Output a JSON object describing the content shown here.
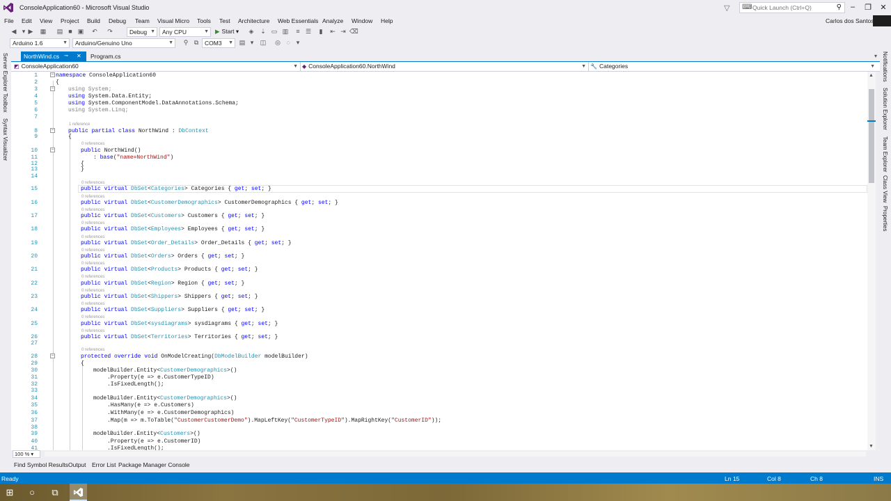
{
  "window": {
    "title": "ConsoleApplication60 - Microsoft Visual Studio",
    "quick_launch_placeholder": "Quick Launch (Ctrl+Q)",
    "user": "Carlos dos Santos"
  },
  "menu": [
    "File",
    "Edit",
    "View",
    "Project",
    "Build",
    "Debug",
    "Team",
    "Visual Micro",
    "Tools",
    "Test",
    "Architecture",
    "Web Essentials",
    "Analyze",
    "Window",
    "Help"
  ],
  "toolbar": {
    "config": "Debug",
    "platform": "Any CPU",
    "start_label": "Start"
  },
  "toolbar2": {
    "board_version": "Arduino 1.6",
    "board": "Arduino/Genuino Uno",
    "port": "COM3"
  },
  "side_tabs_left": [
    "Server Explorer",
    "Toolbox",
    "Syntax Visualizer"
  ],
  "side_tabs_right": [
    "Notifications",
    "Solution Explorer",
    "Team Explorer",
    "Class View",
    "Properties"
  ],
  "doc_tabs": {
    "active": "NorthWind.cs",
    "other": "Program.cs"
  },
  "nav": {
    "project": "ConsoleApplication60",
    "type": "ConsoleApplication60.NorthWind",
    "member": "Categories"
  },
  "code": {
    "lines": [
      {
        "n": "1",
        "text": "namespace ConsoleApplication60"
      },
      {
        "n": "2",
        "text": "{"
      },
      {
        "n": "3",
        "text": "using System;"
      },
      {
        "n": "4",
        "text": "using System.Data.Entity;"
      },
      {
        "n": "5",
        "text": "using System.ComponentModel.DataAnnotations.Schema;"
      },
      {
        "n": "6",
        "text": "using System.Linq;"
      },
      {
        "n": "7",
        "text": ""
      },
      {
        "n": "8",
        "text": "public partial class NorthWind : DbContext"
      },
      {
        "n": "9",
        "text": "{"
      },
      {
        "n": "10",
        "text": "public NorthWind()"
      },
      {
        "n": "11",
        "text": ": base(\"name=NorthWind\")"
      },
      {
        "n": "12",
        "text": "{"
      },
      {
        "n": "13",
        "text": "}"
      },
      {
        "n": "14",
        "text": ""
      },
      {
        "n": "15",
        "text": "public virtual DbSet<Categories> Categories { get; set; }"
      },
      {
        "n": "16",
        "text": "public virtual DbSet<CustomerDemographics> CustomerDemographics { get; set; }"
      },
      {
        "n": "17",
        "text": "public virtual DbSet<Customers> Customers { get; set; }"
      },
      {
        "n": "18",
        "text": "public virtual DbSet<Employees> Employees { get; set; }"
      },
      {
        "n": "19",
        "text": "public virtual DbSet<Order_Details> Order_Details { get; set; }"
      },
      {
        "n": "20",
        "text": "public virtual DbSet<Orders> Orders { get; set; }"
      },
      {
        "n": "21",
        "text": "public virtual DbSet<Products> Products { get; set; }"
      },
      {
        "n": "22",
        "text": "public virtual DbSet<Region> Region { get; set; }"
      },
      {
        "n": "23",
        "text": "public virtual DbSet<Shippers> Shippers { get; set; }"
      },
      {
        "n": "24",
        "text": "public virtual DbSet<Suppliers> Suppliers { get; set; }"
      },
      {
        "n": "25",
        "text": "public virtual DbSet<sysdiagrams> sysdiagrams { get; set; }"
      },
      {
        "n": "26",
        "text": "public virtual DbSet<Territories> Territories { get; set; }"
      },
      {
        "n": "27",
        "text": ""
      },
      {
        "n": "28",
        "text": "protected override void OnModelCreating(DbModelBuilder modelBuilder)"
      },
      {
        "n": "29",
        "text": "{"
      },
      {
        "n": "30",
        "text": "modelBuilder.Entity<CustomerDemographics>()"
      },
      {
        "n": "31",
        "text": ".Property(e => e.CustomerTypeID)"
      },
      {
        "n": "32",
        "text": ".IsFixedLength();"
      },
      {
        "n": "33",
        "text": ""
      },
      {
        "n": "34",
        "text": "modelBuilder.Entity<CustomerDemographics>()"
      },
      {
        "n": "35",
        "text": ".HasMany(e => e.Customers)"
      },
      {
        "n": "36",
        "text": ".WithMany(e => e.CustomerDemographics)"
      },
      {
        "n": "37",
        "text": ".Map(m => m.ToTable(\"CustomerCustomerDemo\").MapLeftKey(\"CustomerTypeID\").MapRightKey(\"CustomerID\"));"
      },
      {
        "n": "38",
        "text": ""
      },
      {
        "n": "39",
        "text": "modelBuilder.Entity<Customers>()"
      },
      {
        "n": "40",
        "text": ".Property(e => e.CustomerID)"
      },
      {
        "n": "41",
        "text": ".IsFixedLength();"
      }
    ],
    "ref_1": "1 reference",
    "ref_0": "0 references"
  },
  "zoom": "100 %",
  "bottom_tabs": [
    "Find Symbol Results",
    "Output",
    "Error List",
    "Package Manager Console"
  ],
  "status": {
    "state": "Ready",
    "line": "Ln 15",
    "col": "Col 8",
    "ch": "Ch 8",
    "mode": "INS"
  },
  "colors": {
    "accent": "#007acc",
    "keyword": "#0000ff",
    "type": "#2b91af",
    "string": "#a31515"
  }
}
